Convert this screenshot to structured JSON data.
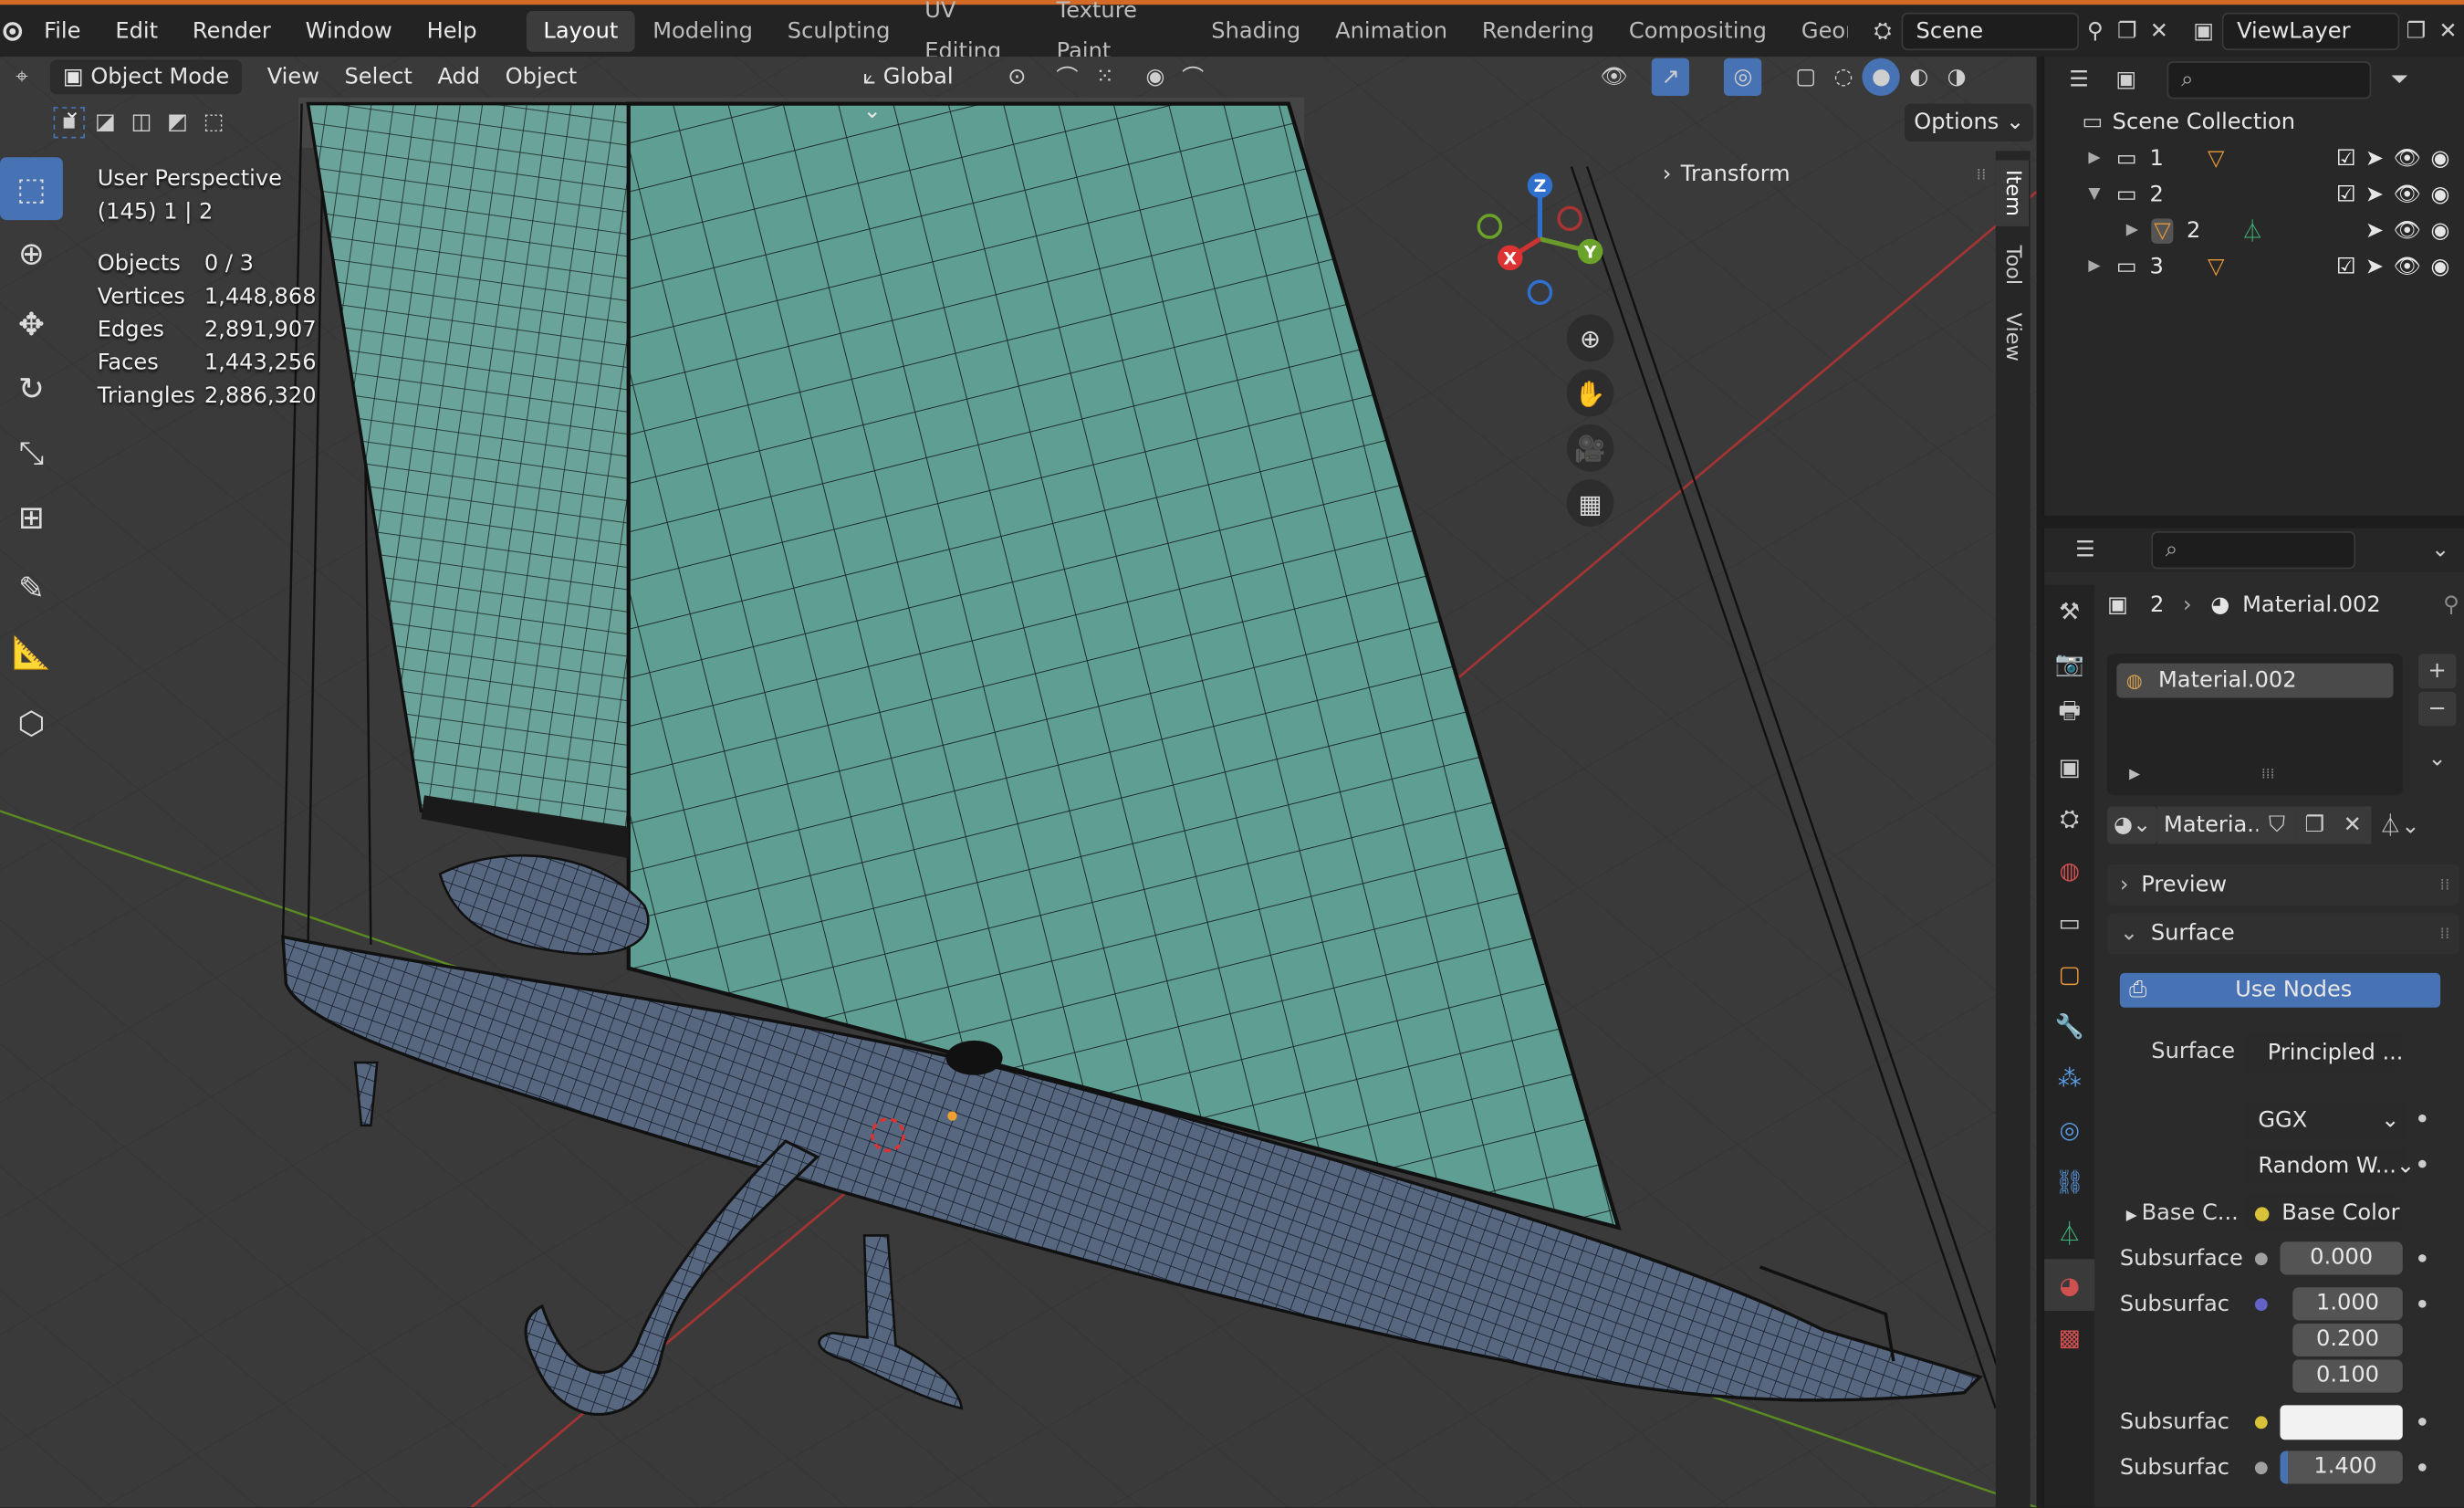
{
  "colors": {
    "accent": "#4772b3",
    "topbar_border": "#d36a28",
    "sail": "#5e9e93",
    "sail_grid": "#1f2f2c",
    "hull": "#56677f",
    "axis_x": "#b33333",
    "axis_y": "#6a9a2a",
    "axis_z": "#2f6fce"
  },
  "menu": {
    "file": "File",
    "edit": "Edit",
    "render": "Render",
    "window": "Window",
    "help": "Help"
  },
  "workspaces": [
    "Layout",
    "Modeling",
    "Sculpting",
    "UV Editing",
    "Texture Paint",
    "Shading",
    "Animation",
    "Rendering",
    "Compositing",
    "Geome"
  ],
  "scene": {
    "name": "Scene"
  },
  "view_layer": {
    "name": "ViewLayer"
  },
  "viewport_header": {
    "mode": "Object Mode",
    "view": "View",
    "select": "Select",
    "add": "Add",
    "object": "Object",
    "transform_orientation": "Global",
    "options": "Options"
  },
  "viewport_info": {
    "perspective": "User Perspective",
    "collection": "(145) 1 | 2",
    "stats": [
      {
        "label": "Objects",
        "value": "0 / 3"
      },
      {
        "label": "Vertices",
        "value": "1,448,868"
      },
      {
        "label": "Edges",
        "value": "2,891,907"
      },
      {
        "label": "Faces",
        "value": "1,443,256"
      },
      {
        "label": "Triangles",
        "value": "2,886,320"
      }
    ]
  },
  "gizmo": {
    "x": "X",
    "y": "Y",
    "z": "Z"
  },
  "npanel": {
    "transform": "Transform",
    "tabs": [
      "Item",
      "Tool",
      "View"
    ]
  },
  "outliner": {
    "root": "Scene Collection",
    "items": [
      "1",
      "2",
      "2",
      "3"
    ]
  },
  "properties": {
    "breadcrumb_object": "2",
    "breadcrumb_material": "Material.002",
    "slot": "Material.002",
    "material_field": "Materia...",
    "preview": "Preview",
    "surface": "Surface",
    "use_nodes": "Use Nodes",
    "surface_label": "Surface",
    "surface_value": "Principled ...",
    "distribution": "GGX",
    "subsurface_method": "Random W...",
    "base_color_label": "Base C...",
    "base_color_value": "Base Color",
    "subsurface_label": "Subsurface",
    "subsurface_value": "0.000",
    "subsurf_radius_label": "Subsurfac",
    "radius_1": "1.000",
    "radius_2": "0.200",
    "radius_3": "0.100",
    "subsurf_color_label": "Subsurfac",
    "subsurf_ior_label": "Subsurfac",
    "subsurf_ior_value": "1.400"
  }
}
